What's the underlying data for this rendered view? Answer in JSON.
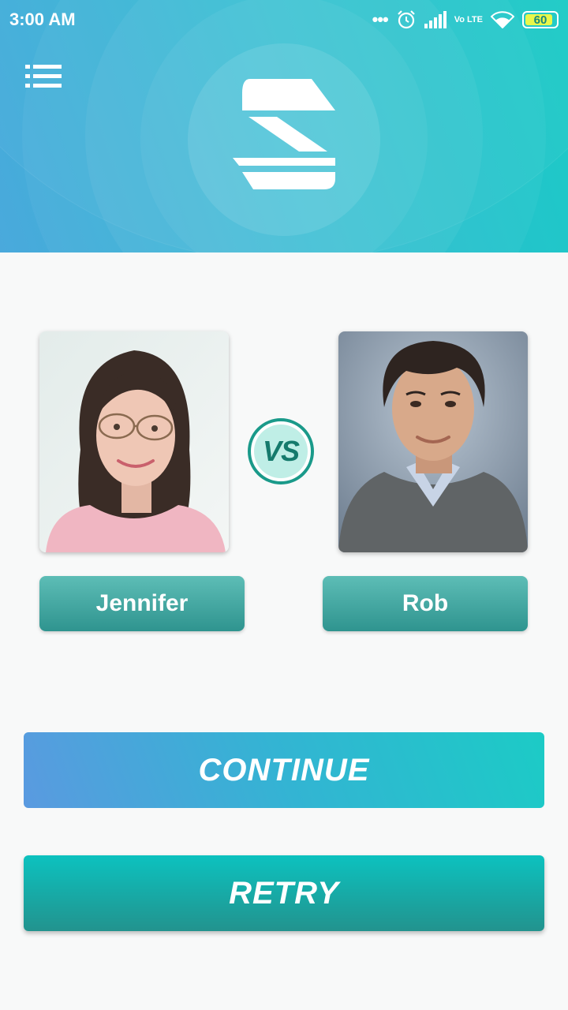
{
  "status_bar": {
    "time": "3:00 AM",
    "network_label": "Vo LTE",
    "battery_level": "60",
    "icons": [
      "dots-icon",
      "alarm-icon",
      "signal-icon",
      "volte-icon",
      "wifi-icon",
      "battery-icon"
    ]
  },
  "header": {
    "menu_icon": "list-menu-icon",
    "logo_icon": "app-logo-icon"
  },
  "comparison": {
    "left_person": {
      "name": "Jennifer",
      "photo": "woman-portrait"
    },
    "right_person": {
      "name": "Rob",
      "photo": "man-portrait"
    },
    "vs_label": "VS"
  },
  "actions": {
    "continue_label": "CONTINUE",
    "retry_label": "RETRY"
  },
  "colors": {
    "accent_teal": "#1ccbc6",
    "accent_blue": "#5a9ae0",
    "name_button": "#3fa39e",
    "vs_border": "#1a9a8a",
    "vs_text": "#157a6c"
  }
}
